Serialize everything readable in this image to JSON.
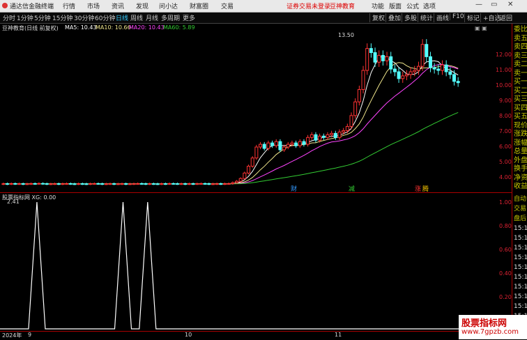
{
  "menu": {
    "app_title": "通达信金融终端",
    "items": [
      "行情",
      "市场",
      "资讯",
      "发现",
      "问小达",
      "财富圈",
      "交易"
    ],
    "notice": "证券交易未登录",
    "brand": "豆神教育",
    "right_items": [
      "功能",
      "版面",
      "公式",
      "选项"
    ],
    "minimize": "—",
    "restore": "▭",
    "close": "✕"
  },
  "toolbar": {
    "periods": [
      "分时",
      "1分钟",
      "5分钟",
      "15分钟",
      "30分钟",
      "60分钟",
      "日线",
      "周线",
      "月线",
      "多周期",
      "更多"
    ],
    "active_period": "日线",
    "right_buttons": [
      "复权",
      "叠加",
      "多股",
      "统计",
      "画线",
      "F10",
      "标记",
      "+自选",
      "返回"
    ]
  },
  "main_chart": {
    "title": "豆神教育(日线 前复权)",
    "ma_labels": [
      {
        "text": "MA5: 10.43",
        "color": "#ffffff"
      },
      {
        "text": "MA10: 10.66",
        "color": "#f0e68c"
      },
      {
        "text": "MA20: 10.43",
        "color": "#ff44ff"
      },
      {
        "text": "MA60: 5.89",
        "color": "#33cc33"
      }
    ],
    "price_ticks": [
      "12.00",
      "11.00",
      "10.00",
      "9.00",
      "8.00",
      "7.00",
      "6.00",
      "5.00",
      "4.00"
    ],
    "high_label": "13.50",
    "low_label": "2.41",
    "event_markers": [
      {
        "text": "财",
        "color": "#3399ff"
      },
      {
        "text": "减",
        "color": "#33cc33"
      },
      {
        "text": "涨",
        "color": "#ff3333"
      },
      {
        "text": "腾",
        "color": "#ffcc00"
      }
    ]
  },
  "sub_chart": {
    "title": "股票指标网 XG: 0.00",
    "ticks": [
      "1.00",
      "0.80",
      "0.60",
      "0.40",
      "0.20"
    ]
  },
  "dates": {
    "labels": [
      "2024年",
      "9",
      "10",
      "11"
    ]
  },
  "right_panel": {
    "labels": [
      "委比",
      "卖五",
      "卖四",
      "卖三",
      "卖二",
      "卖一",
      "买一",
      "买二",
      "买三",
      "买四",
      "买五",
      "现价",
      "涨跌",
      "涨幅",
      "总量",
      "外盘",
      "换手",
      "净资",
      "收益"
    ],
    "lower_labels": [
      "自动",
      "交易",
      "盘后",
      "15:1",
      "15:1",
      "15:1",
      "15:1",
      "15:1",
      "15:1",
      "15:1",
      "15:1",
      "15:1",
      "15:1",
      "15:1"
    ]
  },
  "watermark": {
    "line1": "股票指标网",
    "line2": "www.7gpzb.com"
  },
  "chart_data": [
    {
      "type": "candlestick",
      "title": "豆神教育(日线 前复权)",
      "ylim": [
        2.4,
        13.6
      ],
      "x": [
        1,
        2,
        3,
        4,
        5,
        6,
        7,
        8,
        9,
        10,
        11,
        12,
        13,
        14,
        15,
        16,
        17,
        18,
        19,
        20,
        21,
        22,
        23,
        24,
        25,
        26,
        27,
        28,
        29,
        30,
        31,
        32,
        33,
        34,
        35,
        36,
        37,
        38,
        39,
        40,
        41,
        42,
        43,
        44,
        45,
        46,
        47,
        48,
        49,
        50,
        51,
        52,
        53,
        54,
        55,
        56,
        57,
        58,
        59,
        60,
        61,
        62,
        63,
        64,
        65,
        66,
        67,
        68,
        69,
        70,
        71,
        72,
        73,
        74,
        75,
        76,
        77,
        78,
        79,
        80,
        81,
        82,
        83,
        84,
        85,
        86,
        87,
        88,
        89,
        90,
        91,
        92,
        93,
        94,
        95,
        96,
        97,
        98,
        99,
        100,
        101,
        102,
        103,
        104,
        105,
        106,
        107,
        108,
        109,
        110,
        111,
        112,
        113,
        114,
        115,
        116,
        117,
        118,
        119,
        120,
        121,
        122,
        123,
        124,
        125,
        126,
        127,
        128,
        129,
        130
      ],
      "open": [
        2.6,
        2.62,
        2.6,
        2.63,
        2.61,
        2.62,
        2.6,
        2.61,
        2.63,
        2.62,
        2.64,
        2.62,
        2.6,
        2.61,
        2.62,
        2.6,
        2.62,
        2.63,
        2.61,
        2.6,
        2.62,
        2.61,
        2.6,
        2.62,
        2.63,
        2.62,
        2.6,
        2.61,
        2.62,
        2.6,
        2.61,
        2.62,
        2.6,
        2.61,
        2.62,
        2.63,
        2.62,
        2.6,
        2.62,
        2.61,
        2.6,
        2.62,
        2.61,
        2.63,
        2.62,
        2.61,
        2.62,
        2.6,
        2.62,
        2.61,
        2.62,
        2.63,
        2.62,
        2.6,
        2.61,
        2.62,
        2.61,
        2.62,
        2.63,
        2.7,
        2.8,
        3.0,
        3.4,
        3.9,
        4.5,
        5.3,
        5.5,
        5.2,
        5.6,
        5.4,
        5.7,
        5.1,
        5.3,
        5.5,
        5.6,
        5.4,
        5.7,
        5.5,
        6.0,
        6.2,
        5.8,
        6.1,
        6.0,
        6.2,
        6.3,
        6.0,
        6.4,
        6.5,
        6.8,
        7.6,
        8.6,
        9.5,
        10.9,
        12.5,
        12.2,
        11.5,
        12.0,
        11.6,
        11.9,
        11.0,
        10.8,
        10.3,
        10.5,
        10.6,
        10.8,
        10.9,
        11.2,
        12.8,
        11.9,
        11.1,
        11.0,
        10.9,
        11.3,
        10.8,
        10.6,
        10.1
      ],
      "close": [
        2.62,
        2.6,
        2.63,
        2.61,
        2.62,
        2.6,
        2.61,
        2.63,
        2.62,
        2.64,
        2.62,
        2.6,
        2.61,
        2.62,
        2.6,
        2.62,
        2.63,
        2.61,
        2.6,
        2.62,
        2.61,
        2.6,
        2.62,
        2.63,
        2.62,
        2.6,
        2.61,
        2.62,
        2.6,
        2.61,
        2.62,
        2.6,
        2.61,
        2.62,
        2.63,
        2.62,
        2.6,
        2.62,
        2.61,
        2.6,
        2.62,
        2.61,
        2.63,
        2.62,
        2.61,
        2.62,
        2.6,
        2.62,
        2.61,
        2.62,
        2.63,
        2.62,
        2.6,
        2.61,
        2.62,
        2.61,
        2.62,
        2.63,
        2.7,
        2.8,
        3.0,
        3.4,
        3.9,
        4.5,
        5.3,
        5.5,
        5.2,
        5.6,
        5.4,
        5.7,
        5.1,
        5.3,
        5.5,
        5.6,
        5.4,
        5.7,
        5.5,
        6.0,
        6.2,
        5.8,
        6.1,
        6.0,
        6.2,
        6.3,
        6.0,
        6.4,
        6.5,
        6.8,
        7.6,
        8.6,
        9.5,
        10.9,
        12.5,
        12.2,
        11.5,
        12.0,
        11.6,
        11.9,
        11.0,
        10.8,
        10.3,
        10.5,
        10.6,
        10.8,
        10.9,
        11.2,
        12.8,
        11.9,
        11.1,
        11.0,
        10.9,
        11.3,
        10.8,
        10.6,
        10.1,
        10.0
      ]
    },
    {
      "type": "line",
      "title": "股票指标网 XG: 0.00",
      "ylim": [
        0,
        1.1
      ],
      "spikes_at_fraction": [
        0.075,
        0.25,
        0.3
      ],
      "series": [
        {
          "name": "XG",
          "baseline": 0,
          "peak": 1
        }
      ]
    }
  ]
}
